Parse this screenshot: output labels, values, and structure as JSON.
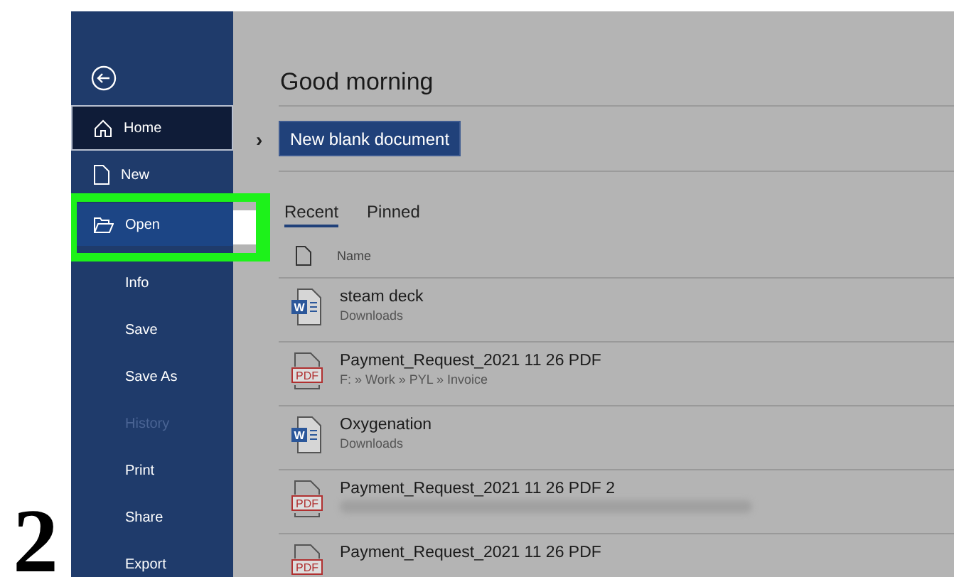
{
  "step_number": "2",
  "sidebar": {
    "items": [
      {
        "label": "Home",
        "kind": "home",
        "selected": true,
        "hovered": false,
        "disabled": false,
        "highlighted": false
      },
      {
        "label": "New",
        "kind": "new",
        "selected": false,
        "hovered": false,
        "disabled": false,
        "highlighted": false
      },
      {
        "label": "Open",
        "kind": "open",
        "selected": false,
        "hovered": true,
        "disabled": false,
        "highlighted": true
      },
      {
        "label": "Info",
        "kind": "plain",
        "selected": false,
        "hovered": false,
        "disabled": false,
        "highlighted": false
      },
      {
        "label": "Save",
        "kind": "plain",
        "selected": false,
        "hovered": false,
        "disabled": false,
        "highlighted": false
      },
      {
        "label": "Save As",
        "kind": "plain",
        "selected": false,
        "hovered": false,
        "disabled": false,
        "highlighted": false
      },
      {
        "label": "History",
        "kind": "plain",
        "selected": false,
        "hovered": false,
        "disabled": true,
        "highlighted": false
      },
      {
        "label": "Print",
        "kind": "plain",
        "selected": false,
        "hovered": false,
        "disabled": false,
        "highlighted": false
      },
      {
        "label": "Share",
        "kind": "plain",
        "selected": false,
        "hovered": false,
        "disabled": false,
        "highlighted": false
      },
      {
        "label": "Export",
        "kind": "plain",
        "selected": false,
        "hovered": false,
        "disabled": false,
        "highlighted": false
      }
    ]
  },
  "main": {
    "greeting": "Good morning",
    "expand_arrow": "›",
    "new_button": "New blank document",
    "tabs": [
      {
        "label": "Recent",
        "selected": true
      },
      {
        "label": "Pinned",
        "selected": false
      }
    ],
    "list_header": "Name",
    "files": [
      {
        "kind": "word",
        "icon_label": "W",
        "name": "steam deck",
        "location": "Downloads",
        "location_blurred": false
      },
      {
        "kind": "pdf",
        "icon_label": "PDF",
        "name": "Payment_Request_2021 11 26 PDF",
        "location": "F: » Work » PYL » Invoice",
        "location_blurred": false
      },
      {
        "kind": "word",
        "icon_label": "W",
        "name": "Oxygenation",
        "location": "Downloads",
        "location_blurred": false
      },
      {
        "kind": "pdf",
        "icon_label": "PDF",
        "name": "Payment_Request_2021 11 26 PDF 2",
        "location_blurred": true
      },
      {
        "kind": "pdf",
        "icon_label": "PDF",
        "name": "Payment_Request_2021 11 26 PDF",
        "location_blurred": false
      }
    ]
  }
}
